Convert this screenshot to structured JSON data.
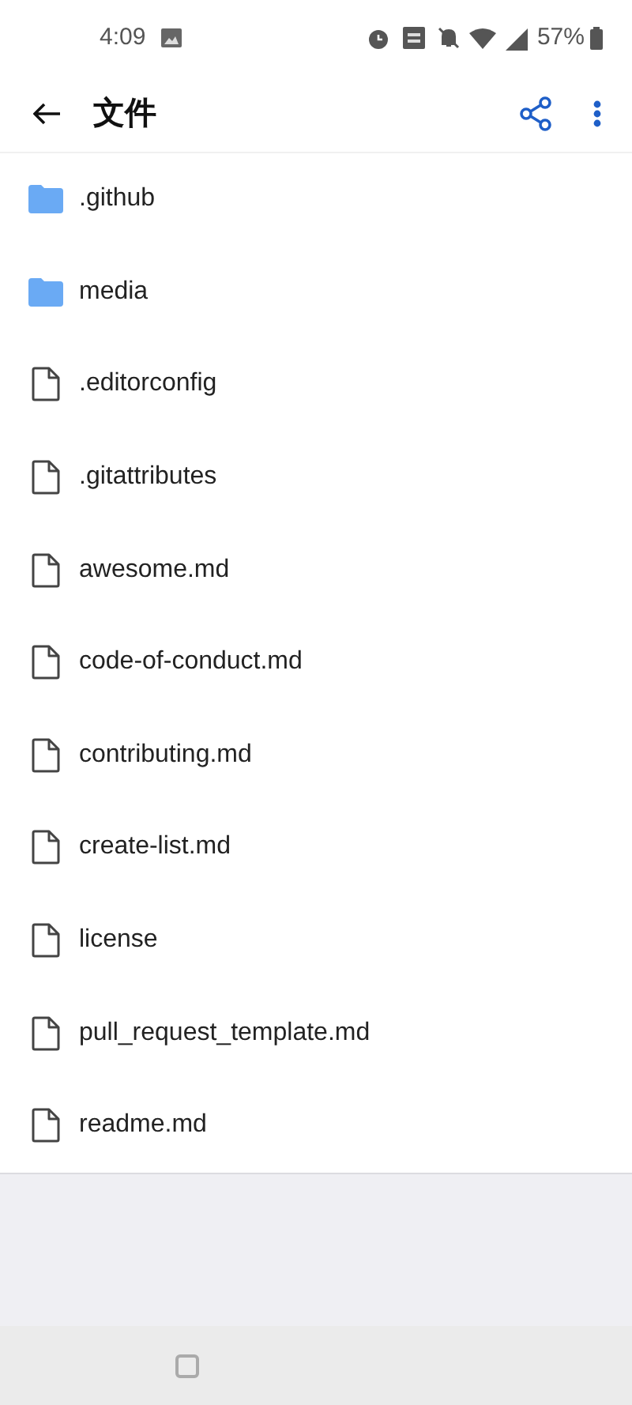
{
  "status_bar": {
    "time": "4:09",
    "battery": "57%"
  },
  "app_bar": {
    "title": "文件"
  },
  "files": [
    {
      "name": ".github",
      "kind": "folder"
    },
    {
      "name": "media",
      "kind": "folder"
    },
    {
      "name": ".editorconfig",
      "kind": "file"
    },
    {
      "name": ".gitattributes",
      "kind": "file"
    },
    {
      "name": "awesome.md",
      "kind": "file"
    },
    {
      "name": "code-of-conduct.md",
      "kind": "file"
    },
    {
      "name": "contributing.md",
      "kind": "file"
    },
    {
      "name": "create-list.md",
      "kind": "file"
    },
    {
      "name": "license",
      "kind": "file"
    },
    {
      "name": "pull_request_template.md",
      "kind": "file"
    },
    {
      "name": "readme.md",
      "kind": "file"
    }
  ]
}
